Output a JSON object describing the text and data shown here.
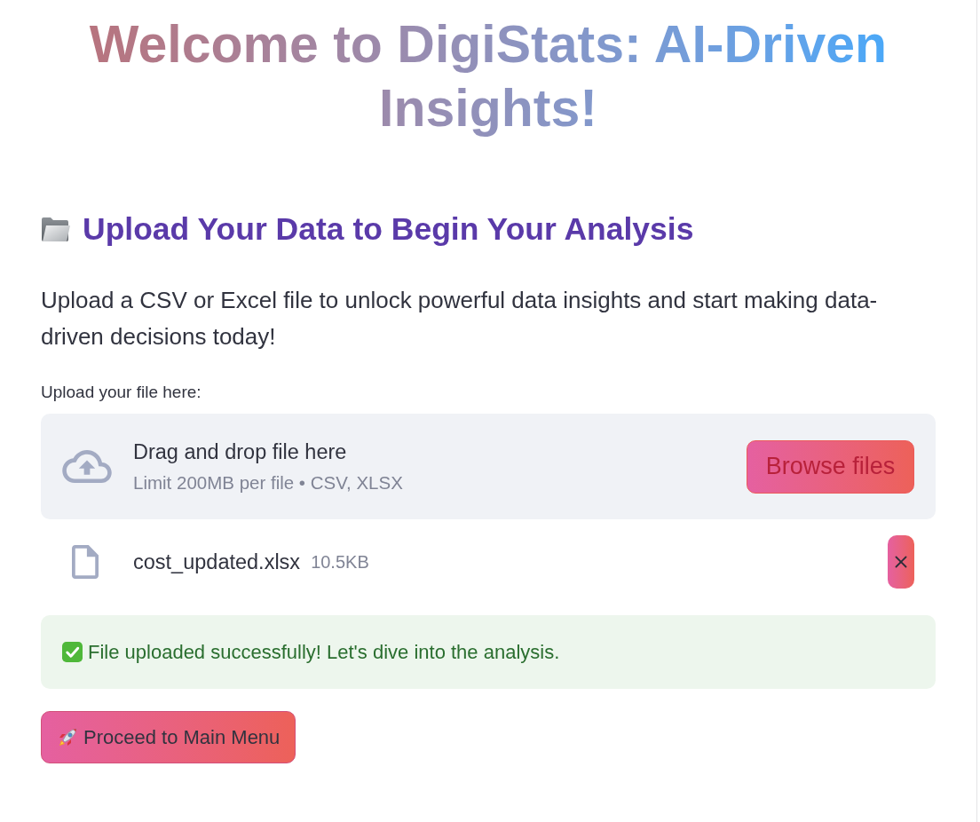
{
  "title": "Welcome to DigiStats: AI-Driven Insights!",
  "section_heading": "Upload Your Data to Begin Your Analysis",
  "intro": "Upload a CSV or Excel file to unlock powerful data insights and start making data-driven decisions today!",
  "uploader": {
    "label": "Upload your file here:",
    "dropzone_title": "Drag and drop file here",
    "dropzone_hint": "Limit 200MB per file • CSV, XLSX",
    "browse_button": "Browse files",
    "files": [
      {
        "name": "cost_updated.xlsx",
        "size": "10.5KB"
      }
    ]
  },
  "alert": {
    "kind": "success",
    "text": "File uploaded successfully! Let's dive into the analysis."
  },
  "proceed_button": "Proceed to Main Menu"
}
